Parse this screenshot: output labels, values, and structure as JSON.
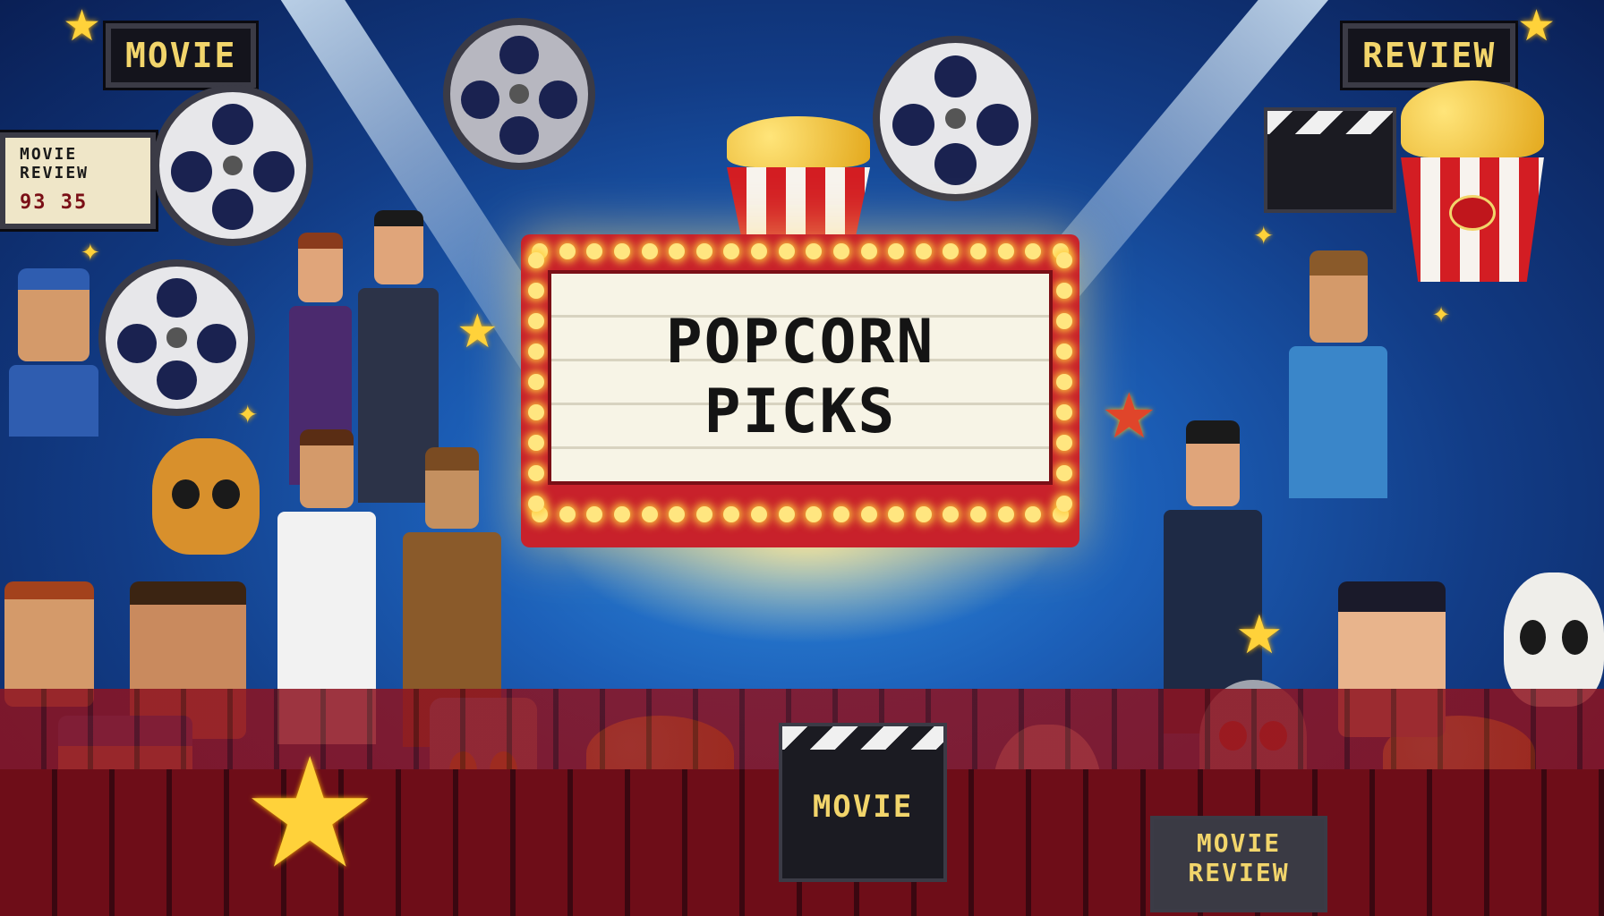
{
  "marquee": {
    "line1": "POPCORN",
    "line2": "PICKS"
  },
  "signs": {
    "top_left": "MOVIE",
    "top_right": "REVIEW",
    "left_board_title": "MOVIE REVIEW",
    "left_board_digits": "93 35"
  },
  "clapperboards": {
    "bottom_center": "MOVIE",
    "bottom_right_line1": "MOVIE",
    "bottom_right_line2": "REVIEW"
  },
  "colors": {
    "background": "#1c5fb8",
    "marquee_red": "#c8212b",
    "bulb": "#ffe680",
    "popcorn_red": "#d31d23",
    "gold_text": "#f2d56b"
  }
}
